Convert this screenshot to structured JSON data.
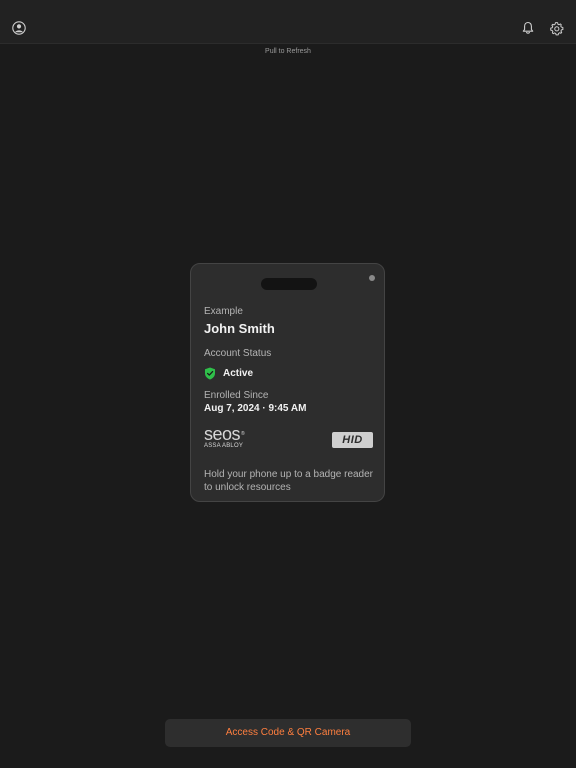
{
  "header": {
    "profile_icon": "person-circle-icon",
    "notifications_icon": "bell-icon",
    "settings_icon": "gear-icon"
  },
  "pull_to_refresh": "Pull to Refresh",
  "badge": {
    "organization": "Example",
    "user_name": "John Smith",
    "account_status_label": "Account Status",
    "account_status_value": "Active",
    "status_color": "#2fbf4a",
    "enrolled_label": "Enrolled Since",
    "enrolled_value": "Aug 7, 2024 · 9:45 AM",
    "seos_logo_text": "seos",
    "assa_abloy_text": "ASSA ABLOY",
    "hid_logo_text": "HID",
    "instructions": "Hold your phone up to a badge reader to unlock resources"
  },
  "bottom_button": {
    "label": "Access Code & QR Camera",
    "color": "#ff7f3f"
  }
}
